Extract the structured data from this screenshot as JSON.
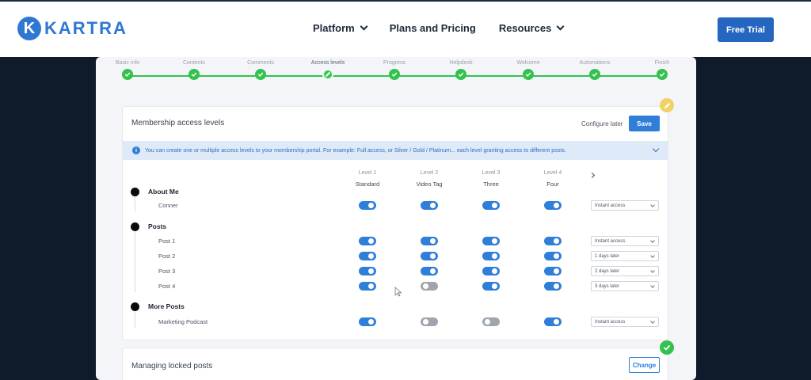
{
  "brand": {
    "logo_letter": "K",
    "name": "KARTRA",
    "color": "#2f78d2"
  },
  "nav": {
    "items": [
      {
        "label": "Platform",
        "dropdown": true
      },
      {
        "label": "Plans and Pricing",
        "dropdown": false
      },
      {
        "label": "Resources",
        "dropdown": true
      }
    ],
    "cta": "Free Trial"
  },
  "stepper": {
    "steps": [
      {
        "label": "Basic info",
        "state": "done"
      },
      {
        "label": "Contents",
        "state": "done"
      },
      {
        "label": "Comments",
        "state": "done"
      },
      {
        "label": "Access levels",
        "state": "current"
      },
      {
        "label": "Progress",
        "state": "done"
      },
      {
        "label": "Helpdesk",
        "state": "done"
      },
      {
        "label": "Welcome",
        "state": "done"
      },
      {
        "label": "Automations",
        "state": "done"
      },
      {
        "label": "Finish",
        "state": "done"
      }
    ]
  },
  "access": {
    "title": "Membership access levels",
    "configure_later": "Configure later",
    "save": "Save",
    "info": "You can create one or multiple access levels to your membership portal. For example: Full access, or Silver / Gold / Platinum... each level granting access to different posts.",
    "levels": [
      {
        "num": "Level 1",
        "name": "Standard"
      },
      {
        "num": "Level 2",
        "name": "Video Tag"
      },
      {
        "num": "Level 3",
        "name": "Three"
      },
      {
        "num": "Level 4",
        "name": "Four"
      }
    ],
    "sections": [
      {
        "name": "About Me",
        "posts": [
          {
            "name": "Conner",
            "toggles": [
              true,
              true,
              true,
              true
            ],
            "release": "Instant access"
          }
        ]
      },
      {
        "name": "Posts",
        "posts": [
          {
            "name": "Post 1",
            "toggles": [
              true,
              true,
              true,
              true
            ],
            "release": "Instant access"
          },
          {
            "name": "Post 2",
            "toggles": [
              true,
              true,
              true,
              true
            ],
            "release": "1 days later"
          },
          {
            "name": "Post 3",
            "toggles": [
              true,
              true,
              true,
              true
            ],
            "release": "2 days later"
          },
          {
            "name": "Post 4",
            "toggles": [
              true,
              false,
              true,
              true
            ],
            "release": "3 days later"
          }
        ]
      },
      {
        "name": "More Posts",
        "posts": [
          {
            "name": "Marketing Podcast",
            "toggles": [
              true,
              false,
              false,
              true
            ],
            "release": "Instant access"
          }
        ]
      }
    ]
  },
  "locked": {
    "title": "Managing locked posts",
    "change": "Change"
  },
  "colors": {
    "accent": "#2f7fd8",
    "success": "#33c24d",
    "edit_badge": "#f3d167",
    "background": "#0f1b2a"
  }
}
